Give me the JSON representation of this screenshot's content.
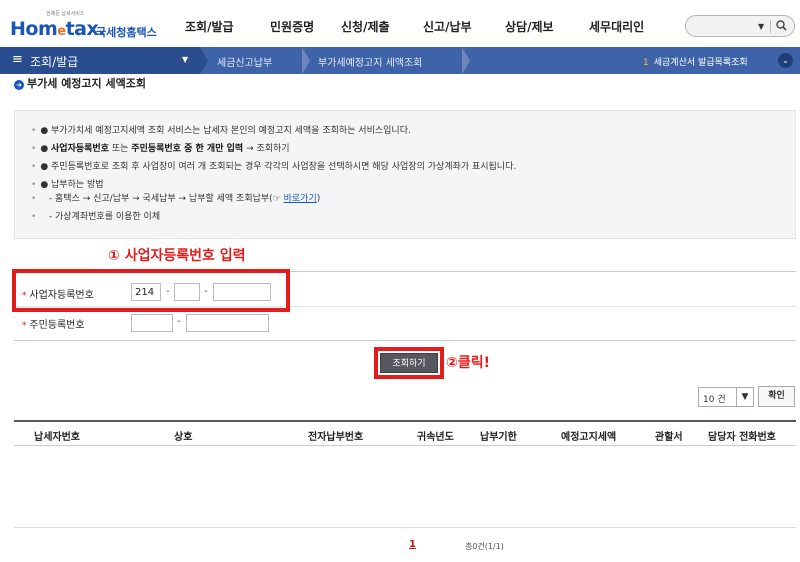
{
  "header": {
    "logo_tagline": "언제든 납세서비스",
    "logo_brand_1": "Hom",
    "logo_brand_e": "e",
    "logo_brand_2": "tax.",
    "logo_sub": "국세청홈택스",
    "gnb": [
      "조회/발급",
      "민원증명",
      "신청/제출",
      "신고/납부",
      "상담/제보",
      "세무대리인"
    ]
  },
  "navbar": {
    "menu_label": "조회/발급",
    "breadcrumb_1": "세금신고납부",
    "breadcrumb_2": "부가세예정고지 세액조회",
    "quick_number": "1",
    "quick_label": "세금계산서 발급목록조회"
  },
  "page": {
    "title": "부가세 예정고지 세액조회"
  },
  "info": {
    "line1": "부가가치세 예정고지세액 조회 서비스는 납세자 본인의 예정고지 세액을 조회하는 서비스입니다.",
    "line2_b1": "사업자등록번호",
    "line2_t1": " 또는 ",
    "line2_b2": "주민등록번호 중 한 개만 입력",
    "line2_t2": " → 조회하기",
    "line3": "주민등록번호로 조회 후 사업장이 여러 개 조회되는 경우 각각의 사업장을 선택하시면 해당 사업장의 가상계좌가 표시됩니다.",
    "line4": "납부하는 방법",
    "line5": "- 홈택스 → 신고/납부 → 국세납부 → 납부할 세액 조회납부(☞ ",
    "line5_link": "바로가기",
    "line5_end": ")",
    "line6": "- 가상계좌번호를 이용한 이체"
  },
  "annotations": {
    "step1": "① 사업자등록번호 입력",
    "step2": "②클릭!"
  },
  "form": {
    "bizno_label": "사업자등록번호",
    "bizno_part1": "214",
    "bizno_part2": "",
    "bizno_part3": "",
    "resno_label": "주민등록번호",
    "resno_part1": "",
    "resno_part2": ""
  },
  "actions": {
    "search_label": "조회하기",
    "pagesize_value": "10 건",
    "confirm_label": "확인"
  },
  "table": {
    "headers": [
      "납세자번호",
      "상호",
      "전자납부번호",
      "귀속년도",
      "납부기한",
      "예정고지세액",
      "관할서",
      "담당자 전화번호"
    ]
  },
  "pagination": {
    "current_page": "1",
    "total": "총0건(1/1)"
  }
}
